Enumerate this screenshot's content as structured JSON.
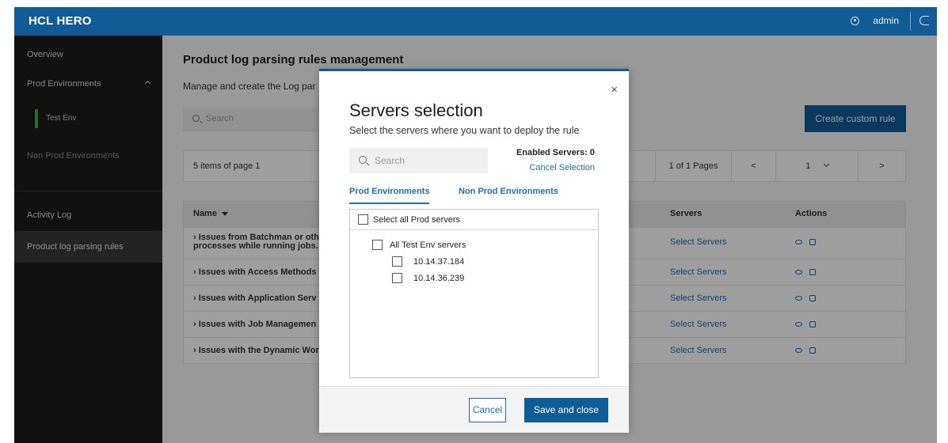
{
  "header": {
    "brand": "HCL HERO",
    "user_name": "admin"
  },
  "sidebar": {
    "items": [
      {
        "label": "Overview"
      },
      {
        "label": "Prod Environments"
      },
      {
        "label": "Test Env"
      },
      {
        "label": "Non Prod Environments"
      },
      {
        "label": "Activity Log"
      },
      {
        "label": "Product log parsing rules"
      }
    ]
  },
  "main": {
    "title": "Product log parsing rules management",
    "description": "Manage and create the Log par",
    "search_placeholder": "Search",
    "create_button": "Create custom rule",
    "pager": {
      "items_text": "5 items of page 1",
      "pages_text": "1 of 1 Pages",
      "prev": "<",
      "current_page": "1",
      "next": ">"
    },
    "table": {
      "columns": {
        "name": "Name",
        "servers": "Servers",
        "actions": "Actions"
      },
      "rows": [
        {
          "name_line1": "›  Issues from Batchman or oth",
          "name_line2": "processes while running jobs.",
          "servers": "Select Servers"
        },
        {
          "name": "›  Issues with Access Methods",
          "servers": "Select Servers"
        },
        {
          "name": "›  Issues with Application Serv",
          "servers": "Select Servers"
        },
        {
          "name": "›  Issues with Job Managemen",
          "servers": "Select Servers"
        },
        {
          "name": "›  Issues with the Dynamic Wor",
          "servers": "Select Servers"
        }
      ]
    }
  },
  "modal": {
    "close": "×",
    "title": "Servers selection",
    "subtitle": "Select the servers where you want to deploy the rule",
    "search_placeholder": "Search",
    "enabled_servers": "Enabled Servers: 0",
    "cancel_selection": "Cancel Selection",
    "tabs": [
      {
        "label": "Prod Environments",
        "active": true
      },
      {
        "label": "Non Prod Environments",
        "active": false
      }
    ],
    "tree": {
      "select_all": "Select all Prod servers",
      "group": "All Test Env servers",
      "servers": [
        "10.14.37.184",
        "10.14.36.239"
      ]
    },
    "buttons": {
      "cancel": "Cancel",
      "save": "Save and close"
    }
  },
  "colors": {
    "brand_blue": "#0f5c97",
    "link_blue": "#1a6fb5",
    "active_green": "#3fae49",
    "sidebar_bg": "#1c1c1c"
  }
}
